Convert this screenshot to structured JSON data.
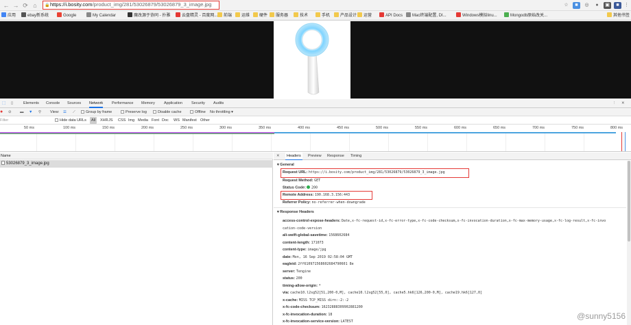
{
  "address_bar": {
    "url_host": "https://i.bosity.com",
    "url_path": "/product_img/281/53026879/53026879_3_image.jpg"
  },
  "bookmarks": [
    {
      "label": "应用",
      "color": "#4285f4"
    },
    {
      "label": "ebay新系统",
      "color": "#555"
    },
    {
      "label": "Google",
      "color": "#ea4335"
    },
    {
      "label": "My Calendar",
      "color": "#888"
    },
    {
      "label": "魔改源于协同 - 扑雅",
      "color": "#333"
    },
    {
      "label": "云盘精灵 - 百度网...",
      "color": "#e53935"
    },
    {
      "label": "前端",
      "color": "#f2c94c"
    },
    {
      "label": "运维",
      "color": "#f2c94c"
    },
    {
      "label": "硬件",
      "color": "#f2c94c"
    },
    {
      "label": "服务器",
      "color": "#f2c94c"
    },
    {
      "label": "技术",
      "color": "#f2c94c"
    },
    {
      "label": "手机",
      "color": "#f2c94c"
    },
    {
      "label": "产品设计",
      "color": "#f2c94c"
    },
    {
      "label": "运营",
      "color": "#f2c94c"
    },
    {
      "label": "API Docs",
      "color": "#e53935"
    },
    {
      "label": "Mac终端配置, DI...",
      "color": "#888"
    },
    {
      "label": "Windows模拟linu...",
      "color": "#e53935"
    },
    {
      "label": "Mongodb原始改关...",
      "color": "#4caf50"
    },
    {
      "label": "其他书签",
      "color": "#f2c94c"
    }
  ],
  "devtools": {
    "tabs": [
      "Elements",
      "Console",
      "Sources",
      "Network",
      "Performance",
      "Memory",
      "Application",
      "Security",
      "Audits"
    ],
    "active_tab": "Network",
    "toolbar": {
      "view_label": "View:",
      "group_by_frame": "Group by frame",
      "preserve_log": "Preserve log",
      "disable_cache": "Disable cache",
      "offline": "Offline",
      "throttling": "No throttling"
    },
    "filter": {
      "placeholder": "Filter",
      "hide_data_urls": "Hide data URLs",
      "types": [
        "All",
        "XHR",
        "JS",
        "CSS",
        "Img",
        "Media",
        "Font",
        "Doc",
        "WS",
        "Manifest",
        "Other"
      ]
    },
    "timeline_ticks": [
      "50 ms",
      "100 ms",
      "150 ms",
      "200 ms",
      "250 ms",
      "300 ms",
      "350 ms",
      "400 ms",
      "450 ms",
      "500 ms",
      "550 ms",
      "600 ms",
      "650 ms",
      "700 ms",
      "750 ms",
      "800 ms"
    ],
    "request_list": {
      "header": "Name",
      "rows": [
        "53026879_3_image.jpg"
      ]
    },
    "detail_tabs": [
      "Headers",
      "Preview",
      "Response",
      "Timing"
    ],
    "active_detail_tab": "Headers",
    "general": {
      "title": "General",
      "request_url_key": "Request URL:",
      "request_url": "https://i.bosity.com/product_img/281/53026879/53026879_3_image.jpg",
      "method_key": "Request Method:",
      "method": "GET",
      "status_key": "Status Code:",
      "status": "200",
      "remote_key": "Remote Address:",
      "remote": "190.168.3.156:443",
      "referrer_key": "Referrer Policy:",
      "referrer": "no-referrer-when-downgrade"
    },
    "response_headers": {
      "title": "Response Headers",
      "rows": [
        {
          "k": "access-control-expose-headers:",
          "v": "Date,x-fc-request-id,x-fc-error-type,x-fc-code-checksum,x-fc-invocation-duration,x-fc-max-memory-usage,x-fc-log-result,x-fc-invo"
        },
        {
          "k": "",
          "v": "cation-code-version"
        },
        {
          "k": "ali-swift-global-savetime:",
          "v": "1568602684"
        },
        {
          "k": "content-length:",
          "v": "171073"
        },
        {
          "k": "content-type:",
          "v": "image/jpg"
        },
        {
          "k": "date:",
          "v": "Mon, 16 Sep 2019 02:58:04 GMT"
        },
        {
          "k": "eagleid:",
          "v": "2ff610971568602684790601 8e"
        },
        {
          "k": "server:",
          "v": "Tengine"
        },
        {
          "k": "status:",
          "v": "200"
        },
        {
          "k": "timing-allow-origin:",
          "v": "*"
        },
        {
          "k": "via:",
          "v": "cache10.l2sg52[51,200-0,M], cache10.l2sg52[55,0], cache5.hk6[126,200-0,M], cache19.hk6[127,0]"
        },
        {
          "k": "x-cache:",
          "v": "MISS TCP_MISS dirn:-2:-2"
        },
        {
          "k": "x-fc-code-checksum:",
          "v": "16232888309902881200"
        },
        {
          "k": "x-fc-invocation-duration:",
          "v": "18"
        },
        {
          "k": "x-fc-invocation-service-version:",
          "v": "LATEST"
        }
      ]
    }
  },
  "watermark": "@sunny5156"
}
